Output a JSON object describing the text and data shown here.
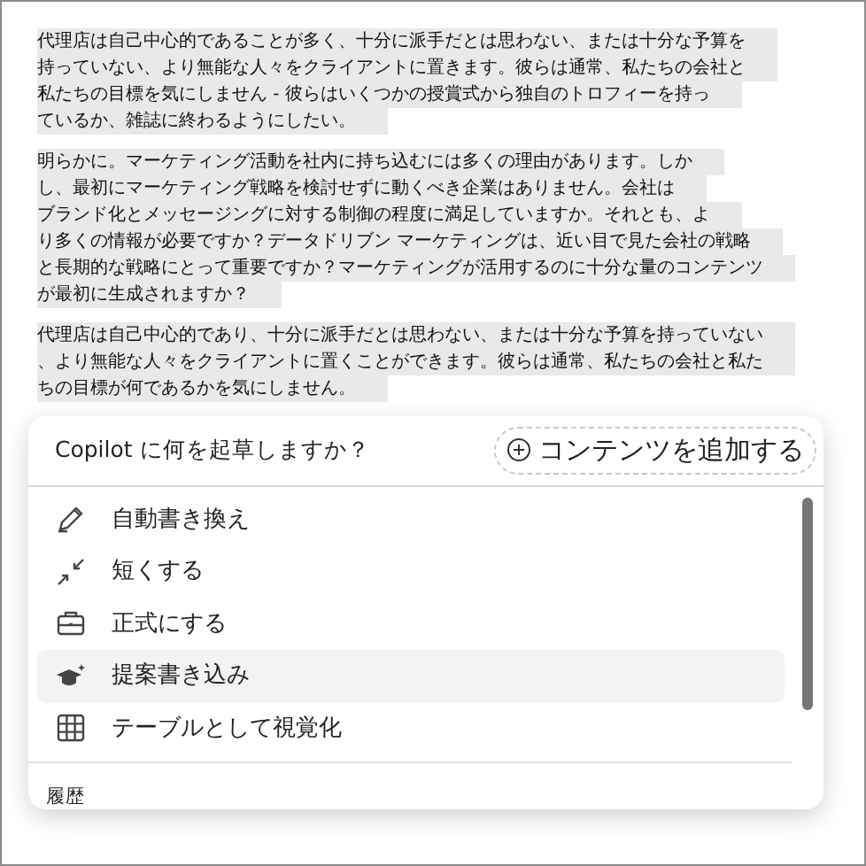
{
  "document": {
    "paragraphs": [
      {
        "lines": [
          "代理店は自己中心的であることが多く、十分に派手だとは思わない、または十分な予算を",
          "持っていない、より無能な人々をクライアントに置きます。彼らは通常、私たちの会社と",
          "私たちの目標を気にしません - 彼らはいくつかの授賞式から独自のトロフィーを持っ",
          "ているか、雑誌に終わるようにしたい。"
        ]
      },
      {
        "lines": [
          "明らかに。マーケティング活動を社内に持ち込むには多くの理由があります。しか",
          "し、最初にマーケティング戦略を検討せずに動くべき企業はありません。会社は",
          "ブランド化とメッセージングに対する制御の程度に満足していますか。それとも、よ",
          "り多くの情報が必要ですか？データドリブン マーケティングは、近い目で見た会社の戦略",
          "と長期的な戦略にとって重要ですか？マーケティングが活用するのに十分な量のコンテンツ",
          "が最初に生成されますか？"
        ]
      },
      {
        "lines": [
          "代理店は自己中心的であり、十分に派手だとは思わない、または十分な予算を持っていない",
          "、より無能な人々をクライアントに置くことができます。彼らは通常、私たちの会社と私た",
          "ちの目標が何であるかを気にしません。"
        ]
      }
    ]
  },
  "prompt_panel": {
    "prompt": "Copilot に何を起草しますか？",
    "add_content_button": "コンテンツを追加する",
    "menu_items": [
      {
        "label": "自動書き換え",
        "selected": false
      },
      {
        "label": "短くする",
        "selected": false
      },
      {
        "label": "正式にする",
        "selected": false
      },
      {
        "label": "提案書き込み",
        "selected": true
      },
      {
        "label": "テーブルとして視覚化",
        "selected": false
      }
    ],
    "history_heading": "履歴"
  }
}
